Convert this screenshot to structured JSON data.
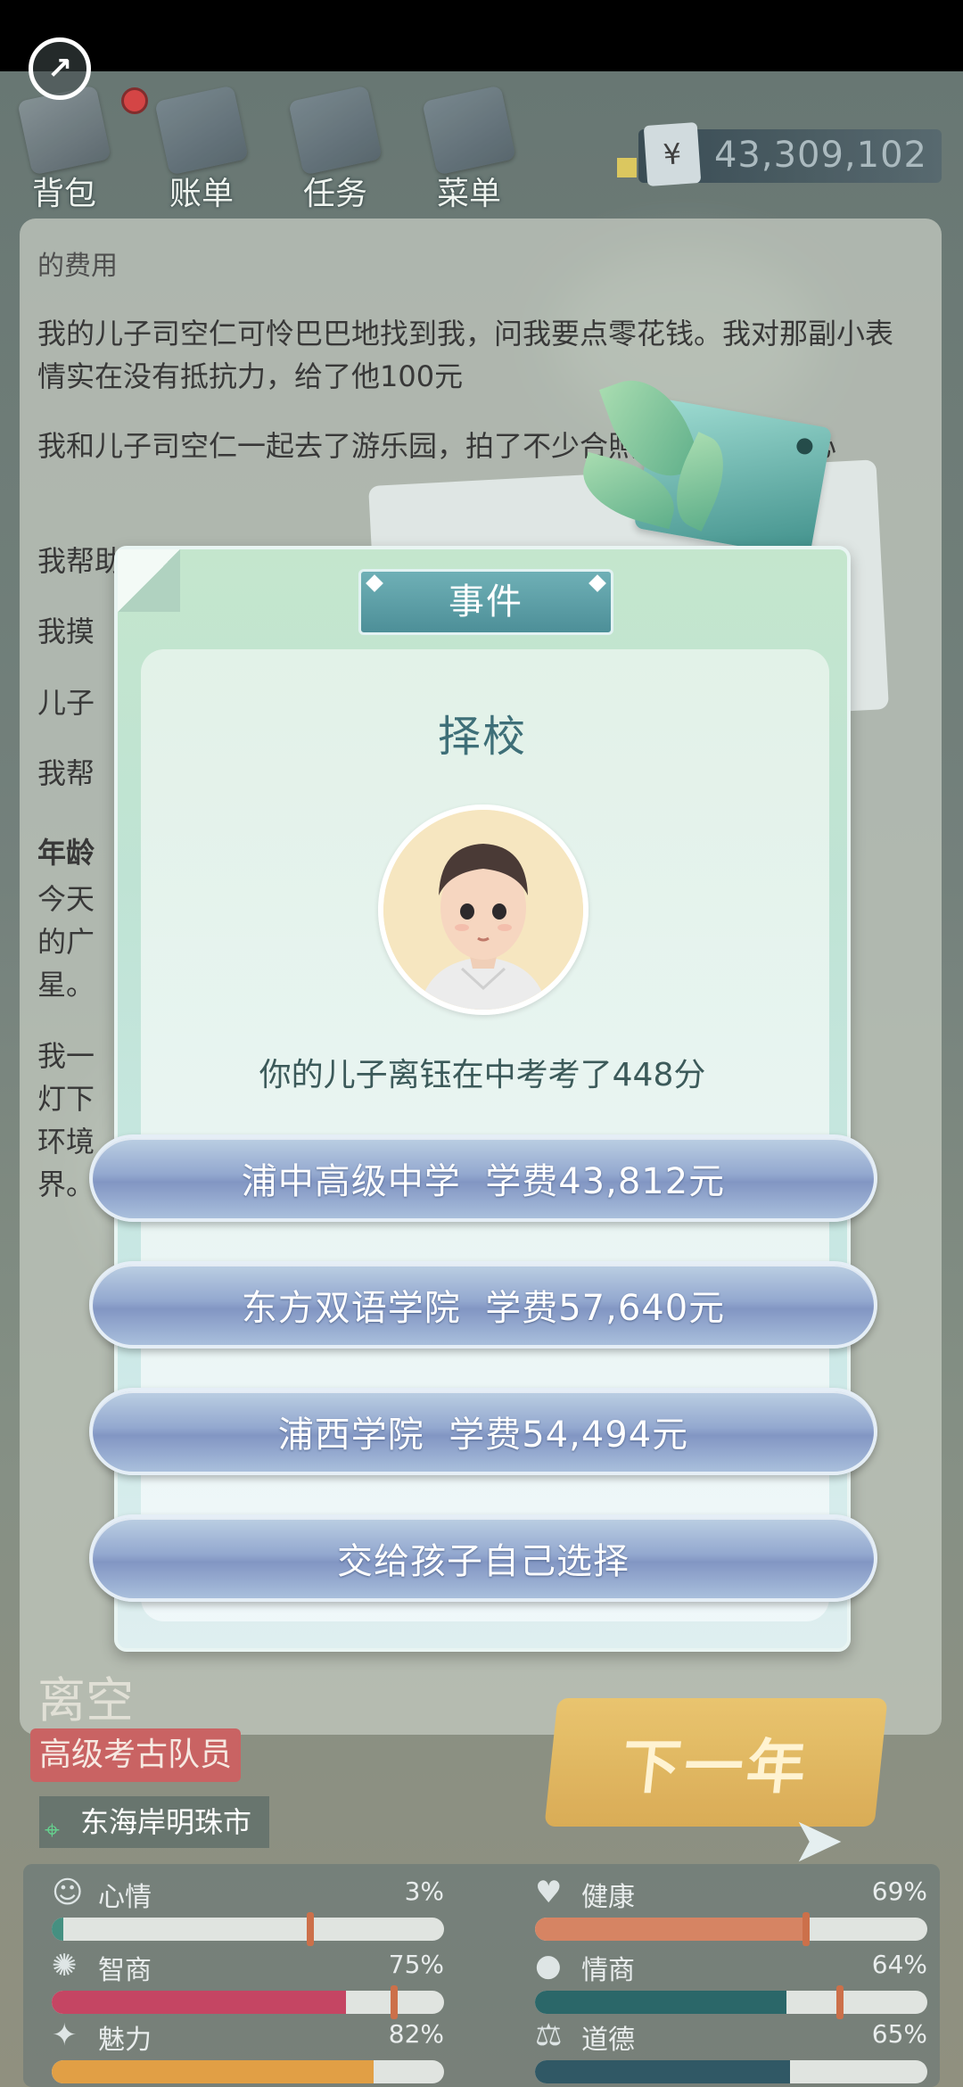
{
  "nav": {
    "items": [
      {
        "label": "背包"
      },
      {
        "label": "账单"
      },
      {
        "label": "任务"
      },
      {
        "label": "菜单"
      }
    ],
    "money_symbol": "¥",
    "money": "43,309,102"
  },
  "log": {
    "partial_top": "的费用",
    "entries": [
      "我的儿子司空仁可怜巴巴地找到我，问我要点零花钱。我对那副小表情实在没有抵抗力，给了他100元",
      "我和儿子司空仁一起去了游乐园，拍了不少合照，儿子非常开心",
      "我帮助儿",
      "我摸",
      "儿子",
      "我帮",
      "年龄",
      "今天",
      "的广",
      "星。",
      "我一",
      "灯下",
      "环境",
      "界。"
    ]
  },
  "modal": {
    "header": "事件",
    "title": "择校",
    "description": "你的儿子离钰在中考考了448分",
    "choices": [
      "浦中高级中学  学费43,812元",
      "东方双语学院  学费57,640元",
      "浦西学院  学费54,494元",
      "交给孩子自己选择"
    ]
  },
  "player": {
    "name": "离空",
    "job": "高级考古队员",
    "city": "东海岸明珠市",
    "next_year": "下一年"
  },
  "stats": [
    {
      "label": "心情",
      "value": "3%",
      "icon": "smiley-icon",
      "fill": 0.03,
      "color": "#3a8a7a"
    },
    {
      "label": "健康",
      "value": "69%",
      "icon": "heart-icon",
      "fill": 0.69,
      "color": "#d47d5a"
    },
    {
      "label": "智商",
      "value": "75%",
      "icon": "bulb-icon",
      "fill": 0.75,
      "color": "#c23a5a"
    },
    {
      "label": "情商",
      "value": "64%",
      "icon": "apple-icon",
      "fill": 0.64,
      "color": "#1e5e60"
    },
    {
      "label": "魅力",
      "value": "82%",
      "icon": "sparkle-icon",
      "fill": 0.82,
      "color": "#e09a3a"
    },
    {
      "label": "道德",
      "value": "65%",
      "icon": "scale-icon",
      "fill": 0.65,
      "color": "#244e5c"
    }
  ]
}
